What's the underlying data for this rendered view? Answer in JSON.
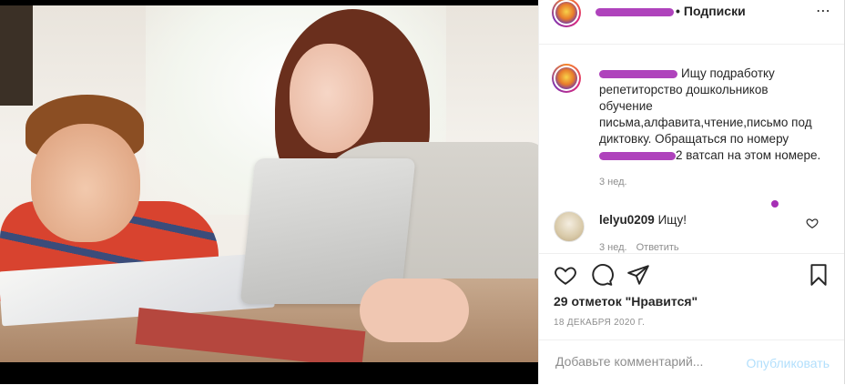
{
  "post": {
    "header": {
      "follow_label": "Подписки",
      "separator": "•",
      "more_label": "⋯"
    },
    "caption": {
      "text_part1": "Ищу подработку\nрепетиторство дошкольников\nобучение\nписьма,алфавита,чтение,письмо под\nдиктовку. Обращаться по номеру",
      "text_part2": "ватсап на этом номере.",
      "number_fragment": "2",
      "time": "3 нед."
    },
    "comment": {
      "username": "lelyu0209",
      "text": "Ищу!",
      "time": "3 нед.",
      "reply_label": "Ответить"
    },
    "likes": "29 отметок \"Нравится\"",
    "date": "18 ДЕКАБРЯ 2020 Г.",
    "add_comment": {
      "placeholder": "Добавьте комментарий...",
      "post_label": "Опубликовать"
    }
  },
  "icons": {
    "like": "heart-icon",
    "comment": "comment-icon",
    "share": "share-icon",
    "save": "bookmark-icon",
    "more": "more-icon"
  },
  "colors": {
    "text": "#262626",
    "muted": "#8e8e8e",
    "post_button_disabled": "#b2dffc",
    "redaction": "#a62fb5"
  }
}
